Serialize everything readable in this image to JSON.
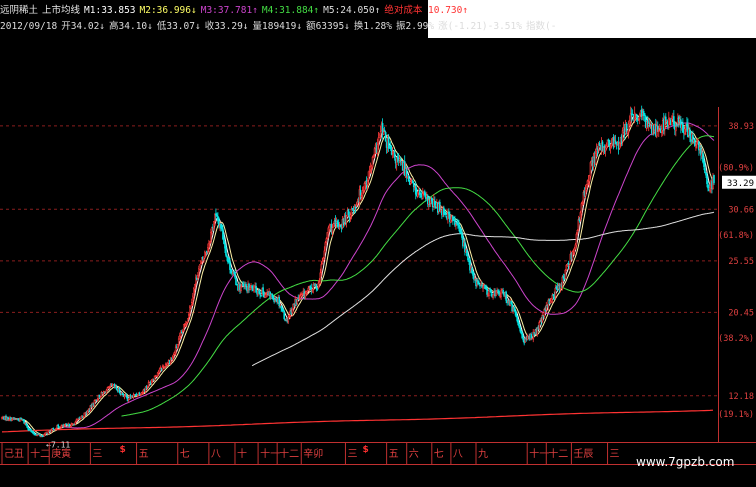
{
  "header": {
    "line1": [
      {
        "text": "远阴稀土",
        "color": "#e6e6e6"
      },
      {
        "text": "上市均线",
        "color": "#e6e6e6"
      },
      {
        "text": "M1:33.853",
        "color": "#ffffff"
      },
      {
        "text": "M2:36.996↓",
        "color": "#ffff66"
      },
      {
        "text": "M3:37.781↑",
        "color": "#cc44cc"
      },
      {
        "text": "M4:31.884↑",
        "color": "#44dd44"
      },
      {
        "text": "M5:24.050↑",
        "color": "#dddddd"
      },
      {
        "text": "绝对成本 10.730↑",
        "color": "#ff3333"
      }
    ],
    "line2": [
      {
        "text": "2012/09/18",
        "color": "#dcdcdc"
      },
      {
        "text": "开34.02↓",
        "color": "#dcdcdc"
      },
      {
        "text": "高34.10↓",
        "color": "#dcdcdc"
      },
      {
        "text": "低33.07↓",
        "color": "#dcdcdc"
      },
      {
        "text": "收33.29↓",
        "color": "#dcdcdc"
      },
      {
        "text": "量189419↓",
        "color": "#dcdcdc"
      },
      {
        "text": "额63395↓",
        "color": "#dcdcdc"
      },
      {
        "text": "换1.28%",
        "color": "#dcdcdc"
      },
      {
        "text": "振2.99%",
        "color": "#dcdcdc"
      },
      {
        "text": "涨(-1.21)-3.51%",
        "color": "#dcdcdc"
      },
      {
        "text": "指数(-",
        "color": "#dcdcdc"
      }
    ]
  },
  "colors": {
    "grid": "#8a1e1e",
    "up_candle": "#ff3b3b",
    "down_candle": "#00e5e5",
    "price_tag_bg": "#ffffff",
    "price_tag_text": "#000000"
  },
  "watermark": "www.7gpzb.com",
  "chart_data": {
    "type": "candlestick",
    "price_axis": {
      "labels": [
        "38.93",
        "(80.9%)",
        "30.66",
        "(61.8%)",
        "25.55",
        "20.45",
        "(38.2%)",
        "12.18",
        "(19.1%)"
      ],
      "ticks": [
        38.93,
        34.8,
        30.66,
        28.1,
        25.55,
        20.45,
        17.9,
        12.18,
        10.4
      ],
      "ylim": [
        7.8,
        40.3
      ],
      "current_price": "33.29",
      "current_value": 33.29,
      "low_annotation": "7.11"
    },
    "time_axis": {
      "labels": [
        "己丑",
        "十二",
        "庚寅",
        "三",
        "五",
        "七",
        "八",
        "十",
        "十一",
        "十二",
        "辛卯",
        "三",
        "五",
        "六",
        "七",
        "八",
        "九",
        "十一",
        "十二",
        "壬辰",
        "三"
      ],
      "bar_index": [
        0,
        26,
        47,
        88,
        134,
        175,
        206,
        232,
        255,
        274,
        298,
        342,
        383,
        403,
        428,
        447,
        472,
        523,
        542,
        567,
        603
      ],
      "markers": [
        "$",
        "$"
      ],
      "marker_index": [
        120,
        362
      ]
    },
    "bar_count": 710,
    "series": [
      {
        "name": "M1",
        "color": "#ffffff"
      },
      {
        "name": "M2",
        "color": "#ffff66"
      },
      {
        "name": "M3",
        "color": "#cc44cc"
      },
      {
        "name": "M4",
        "color": "#44dd44"
      },
      {
        "name": "M5",
        "color": "#dddddd"
      },
      {
        "name": "绝对成本",
        "color": "#ff3333"
      }
    ]
  }
}
